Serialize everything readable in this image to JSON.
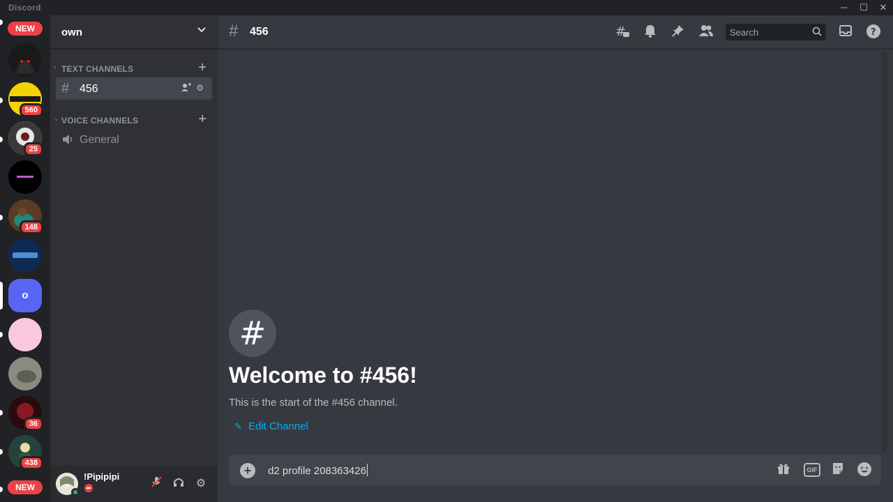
{
  "window": {
    "app_name": "Discord",
    "controls": {
      "minimize": "─",
      "maximize": "☐",
      "close": "✕"
    }
  },
  "guilds": {
    "items": [
      {
        "badge": "NEW",
        "kind": "new",
        "color": "#202225"
      },
      {
        "badge": "",
        "color": "#1a1a1a"
      },
      {
        "badge": "560",
        "color": "#f2d400"
      },
      {
        "badge": "25",
        "color": "#d9d9d9"
      },
      {
        "badge": "",
        "color": "#000000"
      },
      {
        "badge": "148",
        "color": "#3d2b1f"
      },
      {
        "badge": "",
        "color": "#10284a"
      },
      {
        "badge": "",
        "label": "o",
        "color": "#5865f2",
        "selected": true
      },
      {
        "badge": "",
        "color": "#f9c8dc"
      },
      {
        "badge": "",
        "color": "#7a7a72"
      },
      {
        "badge": "36",
        "color": "#3a0c10"
      },
      {
        "badge": "438",
        "color": "#1f3a2c"
      },
      {
        "badge": "NEW",
        "kind": "new",
        "color": "#202225"
      }
    ]
  },
  "sidebar": {
    "server_name": "own",
    "categories": [
      {
        "label": "TEXT CHANNELS",
        "channels": [
          {
            "name": "456",
            "type": "text",
            "active": true
          }
        ]
      },
      {
        "label": "VOICE CHANNELS",
        "channels": [
          {
            "name": "General",
            "type": "voice",
            "active": false
          }
        ]
      }
    ]
  },
  "user": {
    "name": "!Pipipipi",
    "status": "dnd"
  },
  "channel_header": {
    "name": "456",
    "search_placeholder": "Search"
  },
  "welcome": {
    "title": "Welcome to #456!",
    "subtitle": "This is the start of the #456 channel.",
    "edit_label": "Edit Channel"
  },
  "composer": {
    "value": "d2 profile 208363426",
    "gif_label": "GIF"
  },
  "colors": {
    "accent": "#5865f2",
    "link": "#00aff4",
    "danger": "#ed4245",
    "online": "#3ba55d"
  }
}
